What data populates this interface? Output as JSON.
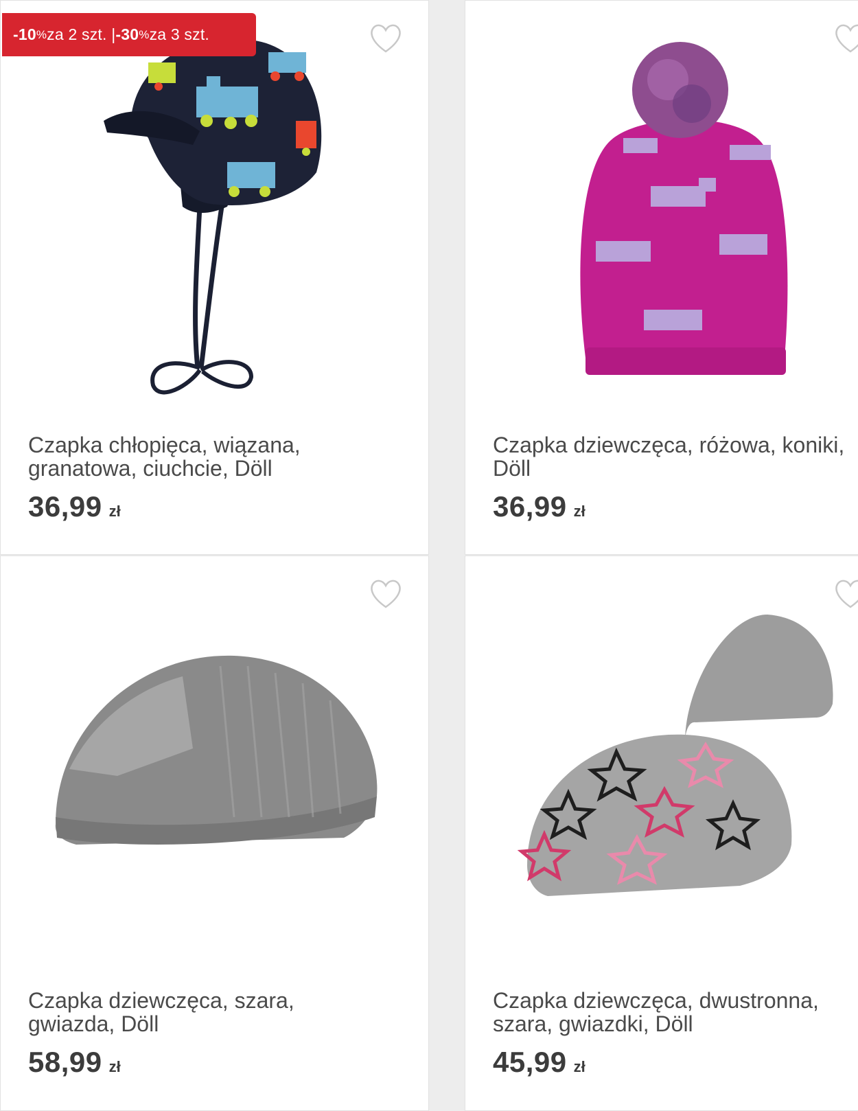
{
  "products": [
    {
      "promo": {
        "part1": "-10",
        "pct1": "%",
        "text1": " za 2 szt. | ",
        "part2": "-30",
        "pct2": "%",
        "text2": " za 3 szt."
      },
      "title_line1": "Czapka chłopięca, wiązana,",
      "title_line2": "granatowa, ciuchcie, Döll",
      "price": "36,99",
      "currency": "zł"
    },
    {
      "title_line1": "Czapka dziewczęca, różowa, koniki,",
      "title_line2": "Döll",
      "price": "36,99",
      "currency": "zł"
    },
    {
      "title_line1": "Czapka dziewczęca, szara,",
      "title_line2": "gwiazda, Döll",
      "price": "58,99",
      "currency": "zł"
    },
    {
      "title_line1": "Czapka dziewczęca, dwustronna,",
      "title_line2": "szara, gwiazdki, Döll",
      "price": "45,99",
      "currency": "zł"
    }
  ],
  "colors": {
    "promo_bg": "#d7252f",
    "heart_outline": "#c8c8c8",
    "text": "#4a4a4a",
    "page_bg": "#ededed"
  }
}
